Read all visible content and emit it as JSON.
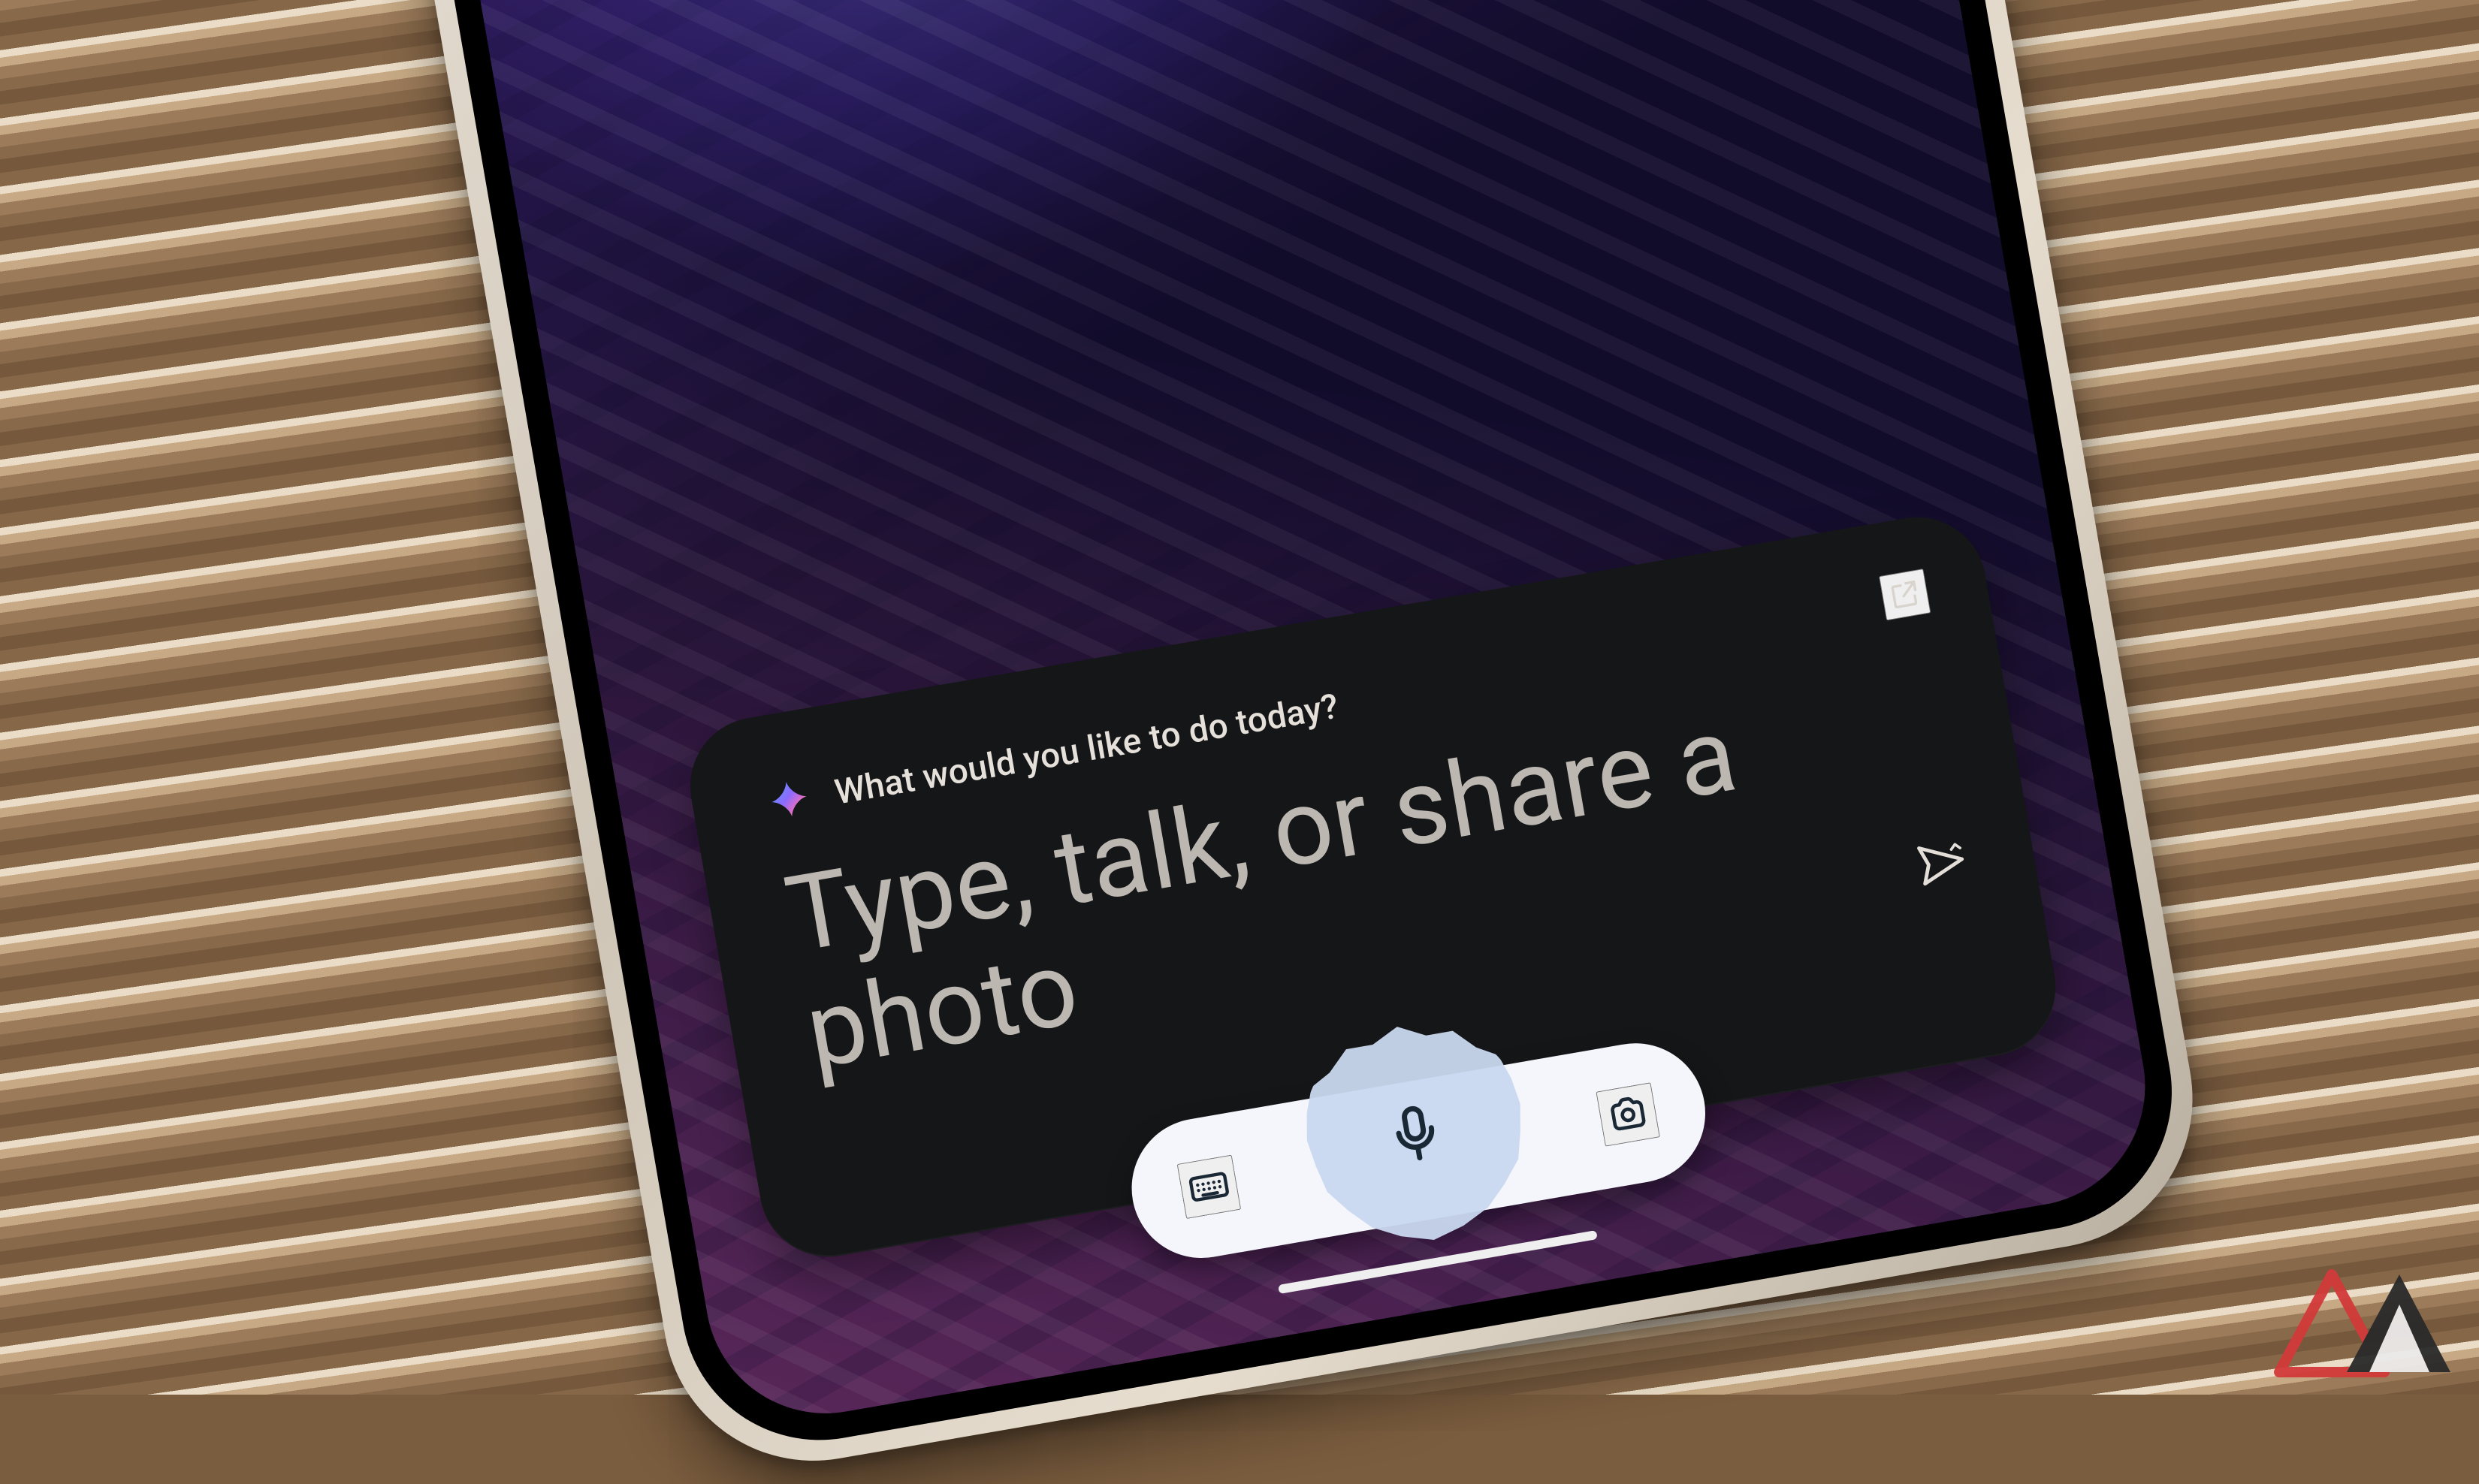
{
  "card": {
    "header": "What would you like to do today?",
    "prompt": "Type, talk, or share a photo"
  },
  "icons": {
    "sparkle": "gemini-sparkle-icon",
    "open": "open-external-icon",
    "send": "send-icon",
    "keyboard": "keyboard-icon",
    "mic": "microphone-icon",
    "camera": "camera-icon"
  }
}
